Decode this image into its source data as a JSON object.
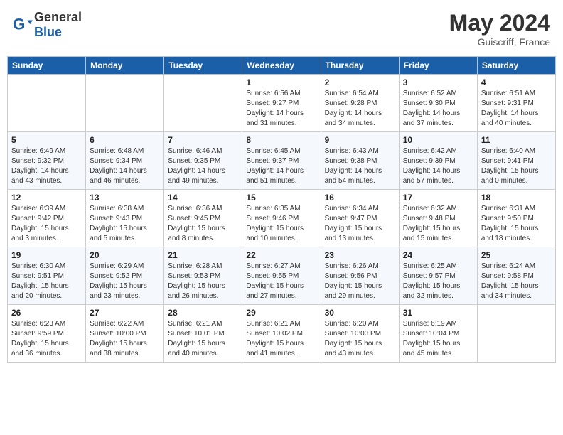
{
  "header": {
    "logo_general": "General",
    "logo_blue": "Blue",
    "month_year": "May 2024",
    "location": "Guiscriff, France"
  },
  "weekdays": [
    "Sunday",
    "Monday",
    "Tuesday",
    "Wednesday",
    "Thursday",
    "Friday",
    "Saturday"
  ],
  "weeks": [
    [
      {
        "day": "",
        "info": ""
      },
      {
        "day": "",
        "info": ""
      },
      {
        "day": "",
        "info": ""
      },
      {
        "day": "1",
        "info": "Sunrise: 6:56 AM\nSunset: 9:27 PM\nDaylight: 14 hours\nand 31 minutes."
      },
      {
        "day": "2",
        "info": "Sunrise: 6:54 AM\nSunset: 9:28 PM\nDaylight: 14 hours\nand 34 minutes."
      },
      {
        "day": "3",
        "info": "Sunrise: 6:52 AM\nSunset: 9:30 PM\nDaylight: 14 hours\nand 37 minutes."
      },
      {
        "day": "4",
        "info": "Sunrise: 6:51 AM\nSunset: 9:31 PM\nDaylight: 14 hours\nand 40 minutes."
      }
    ],
    [
      {
        "day": "5",
        "info": "Sunrise: 6:49 AM\nSunset: 9:32 PM\nDaylight: 14 hours\nand 43 minutes."
      },
      {
        "day": "6",
        "info": "Sunrise: 6:48 AM\nSunset: 9:34 PM\nDaylight: 14 hours\nand 46 minutes."
      },
      {
        "day": "7",
        "info": "Sunrise: 6:46 AM\nSunset: 9:35 PM\nDaylight: 14 hours\nand 49 minutes."
      },
      {
        "day": "8",
        "info": "Sunrise: 6:45 AM\nSunset: 9:37 PM\nDaylight: 14 hours\nand 51 minutes."
      },
      {
        "day": "9",
        "info": "Sunrise: 6:43 AM\nSunset: 9:38 PM\nDaylight: 14 hours\nand 54 minutes."
      },
      {
        "day": "10",
        "info": "Sunrise: 6:42 AM\nSunset: 9:39 PM\nDaylight: 14 hours\nand 57 minutes."
      },
      {
        "day": "11",
        "info": "Sunrise: 6:40 AM\nSunset: 9:41 PM\nDaylight: 15 hours\nand 0 minutes."
      }
    ],
    [
      {
        "day": "12",
        "info": "Sunrise: 6:39 AM\nSunset: 9:42 PM\nDaylight: 15 hours\nand 3 minutes."
      },
      {
        "day": "13",
        "info": "Sunrise: 6:38 AM\nSunset: 9:43 PM\nDaylight: 15 hours\nand 5 minutes."
      },
      {
        "day": "14",
        "info": "Sunrise: 6:36 AM\nSunset: 9:45 PM\nDaylight: 15 hours\nand 8 minutes."
      },
      {
        "day": "15",
        "info": "Sunrise: 6:35 AM\nSunset: 9:46 PM\nDaylight: 15 hours\nand 10 minutes."
      },
      {
        "day": "16",
        "info": "Sunrise: 6:34 AM\nSunset: 9:47 PM\nDaylight: 15 hours\nand 13 minutes."
      },
      {
        "day": "17",
        "info": "Sunrise: 6:32 AM\nSunset: 9:48 PM\nDaylight: 15 hours\nand 15 minutes."
      },
      {
        "day": "18",
        "info": "Sunrise: 6:31 AM\nSunset: 9:50 PM\nDaylight: 15 hours\nand 18 minutes."
      }
    ],
    [
      {
        "day": "19",
        "info": "Sunrise: 6:30 AM\nSunset: 9:51 PM\nDaylight: 15 hours\nand 20 minutes."
      },
      {
        "day": "20",
        "info": "Sunrise: 6:29 AM\nSunset: 9:52 PM\nDaylight: 15 hours\nand 23 minutes."
      },
      {
        "day": "21",
        "info": "Sunrise: 6:28 AM\nSunset: 9:53 PM\nDaylight: 15 hours\nand 26 minutes."
      },
      {
        "day": "22",
        "info": "Sunrise: 6:27 AM\nSunset: 9:55 PM\nDaylight: 15 hours\nand 27 minutes."
      },
      {
        "day": "23",
        "info": "Sunrise: 6:26 AM\nSunset: 9:56 PM\nDaylight: 15 hours\nand 29 minutes."
      },
      {
        "day": "24",
        "info": "Sunrise: 6:25 AM\nSunset: 9:57 PM\nDaylight: 15 hours\nand 32 minutes."
      },
      {
        "day": "25",
        "info": "Sunrise: 6:24 AM\nSunset: 9:58 PM\nDaylight: 15 hours\nand 34 minutes."
      }
    ],
    [
      {
        "day": "26",
        "info": "Sunrise: 6:23 AM\nSunset: 9:59 PM\nDaylight: 15 hours\nand 36 minutes."
      },
      {
        "day": "27",
        "info": "Sunrise: 6:22 AM\nSunset: 10:00 PM\nDaylight: 15 hours\nand 38 minutes."
      },
      {
        "day": "28",
        "info": "Sunrise: 6:21 AM\nSunset: 10:01 PM\nDaylight: 15 hours\nand 40 minutes."
      },
      {
        "day": "29",
        "info": "Sunrise: 6:21 AM\nSunset: 10:02 PM\nDaylight: 15 hours\nand 41 minutes."
      },
      {
        "day": "30",
        "info": "Sunrise: 6:20 AM\nSunset: 10:03 PM\nDaylight: 15 hours\nand 43 minutes."
      },
      {
        "day": "31",
        "info": "Sunrise: 6:19 AM\nSunset: 10:04 PM\nDaylight: 15 hours\nand 45 minutes."
      },
      {
        "day": "",
        "info": ""
      }
    ]
  ]
}
